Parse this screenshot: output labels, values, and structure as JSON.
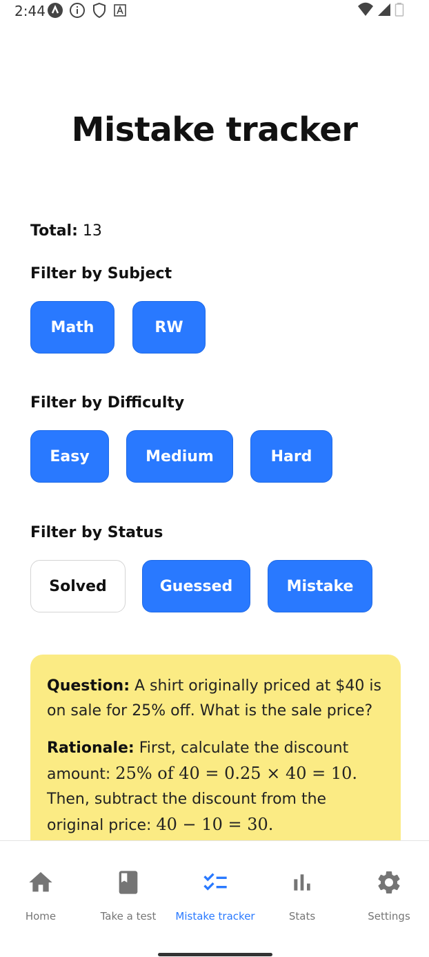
{
  "status_bar": {
    "time": "2:44",
    "icons_left": [
      "vpn-a-icon",
      "info-icon",
      "shield-icon",
      "font-icon"
    ],
    "icons_right": [
      "wifi-icon",
      "signal-icon",
      "battery-icon"
    ]
  },
  "page": {
    "title": "Mistake tracker"
  },
  "summary": {
    "total_label": "Total:",
    "total_value": "13"
  },
  "filters": {
    "subject": {
      "heading": "Filter by Subject",
      "options": [
        {
          "label": "Math",
          "active": true
        },
        {
          "label": "RW",
          "active": true
        }
      ]
    },
    "difficulty": {
      "heading": "Filter by Difficulty",
      "options": [
        {
          "label": "Easy",
          "active": true
        },
        {
          "label": "Medium",
          "active": true
        },
        {
          "label": "Hard",
          "active": true
        }
      ]
    },
    "status": {
      "heading": "Filter by Status",
      "options": [
        {
          "label": "Solved",
          "active": false
        },
        {
          "label": "Guessed",
          "active": true
        },
        {
          "label": "Mistake",
          "active": true
        }
      ]
    }
  },
  "card": {
    "question_label": "Question:",
    "question_text": "A shirt originally priced at $40 is on sale for 25% off. What is the sale price?",
    "rationale_label": "Rationale:",
    "rationale_text_1": "First, calculate the discount amount:",
    "rationale_math_1": "25% of 40 = 0.25 × 40 = 10",
    "rationale_text_2": "Then, subtract the discount from the original price:",
    "rationale_math_2": "40 − 10 = 30"
  },
  "bottom_nav": {
    "items": [
      {
        "label": "Home",
        "icon": "home-icon",
        "active": false
      },
      {
        "label": "Take a test",
        "icon": "book-icon",
        "active": false
      },
      {
        "label": "Mistake tracker",
        "icon": "checklist-icon",
        "active": true
      },
      {
        "label": "Stats",
        "icon": "bar-chart-icon",
        "active": false
      },
      {
        "label": "Settings",
        "icon": "gear-icon",
        "active": false
      }
    ]
  },
  "colors": {
    "accent": "#2979ff",
    "card_background": "#fbeb84",
    "inactive_nav": "#757575"
  }
}
